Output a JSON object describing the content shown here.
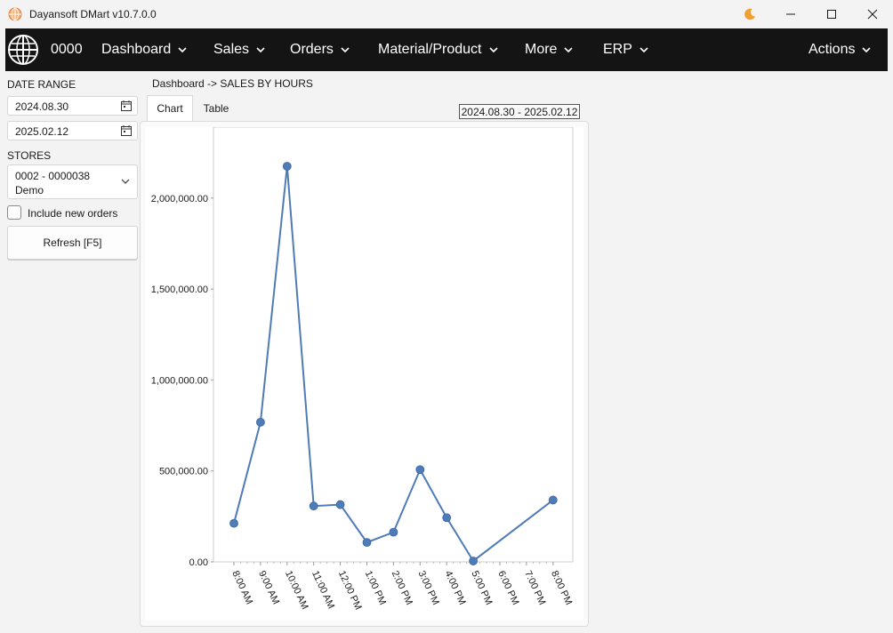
{
  "window": {
    "title": "Dayansoft DMart v10.7.0.0",
    "theme_icon": "moon-icon"
  },
  "menubar": {
    "store_code": "0000",
    "items": [
      {
        "label": "Dashboard"
      },
      {
        "label": "Sales"
      },
      {
        "label": "Orders"
      },
      {
        "label": "Material/Product"
      },
      {
        "label": "More"
      },
      {
        "label": "ERP"
      }
    ],
    "actions_label": "Actions"
  },
  "filters": {
    "date_range_label": "DATE RANGE",
    "date_from": "2024.08.30",
    "date_to": "2025.02.12",
    "stores_label": "STORES",
    "store_line1": "0002 - 0000038",
    "store_line2": "Demo",
    "include_new_orders_label": "Include new orders",
    "include_new_orders_checked": false,
    "refresh_label": "Refresh [F5]"
  },
  "content": {
    "breadcrumb": "Dashboard -> SALES BY HOURS",
    "tabs": [
      {
        "label": "Chart",
        "active": true
      },
      {
        "label": "Table",
        "active": false
      }
    ],
    "date_badge": "2024.08.30 - 2025.02.12"
  },
  "colors": {
    "menubar_bg": "#141414",
    "series": "#4f7bb7",
    "accent_moon": "#f0a030"
  },
  "chart_data": {
    "type": "line",
    "x": [
      "8:00 AM",
      "9:00 AM",
      "10:00 AM",
      "11:00 AM",
      "12:00 PM",
      "1:00 PM",
      "2:00 PM",
      "3:00 PM",
      "4:00 PM",
      "5:00 PM",
      "6:00 PM",
      "7:00 PM",
      "8:00 PM"
    ],
    "series": [
      {
        "values": [
          212000,
          768000,
          2175000,
          307000,
          315000,
          107000,
          163000,
          507000,
          243000,
          5000,
          null,
          null,
          340000
        ]
      }
    ],
    "yticks": [
      0,
      500000,
      1000000,
      1500000,
      2000000
    ],
    "ytick_labels": [
      "0.00",
      "500,000.00",
      "1,000,000.00",
      "1,500,000.00",
      "2,000,000.00"
    ],
    "ylim": [
      0,
      2390000
    ],
    "grid": false
  }
}
